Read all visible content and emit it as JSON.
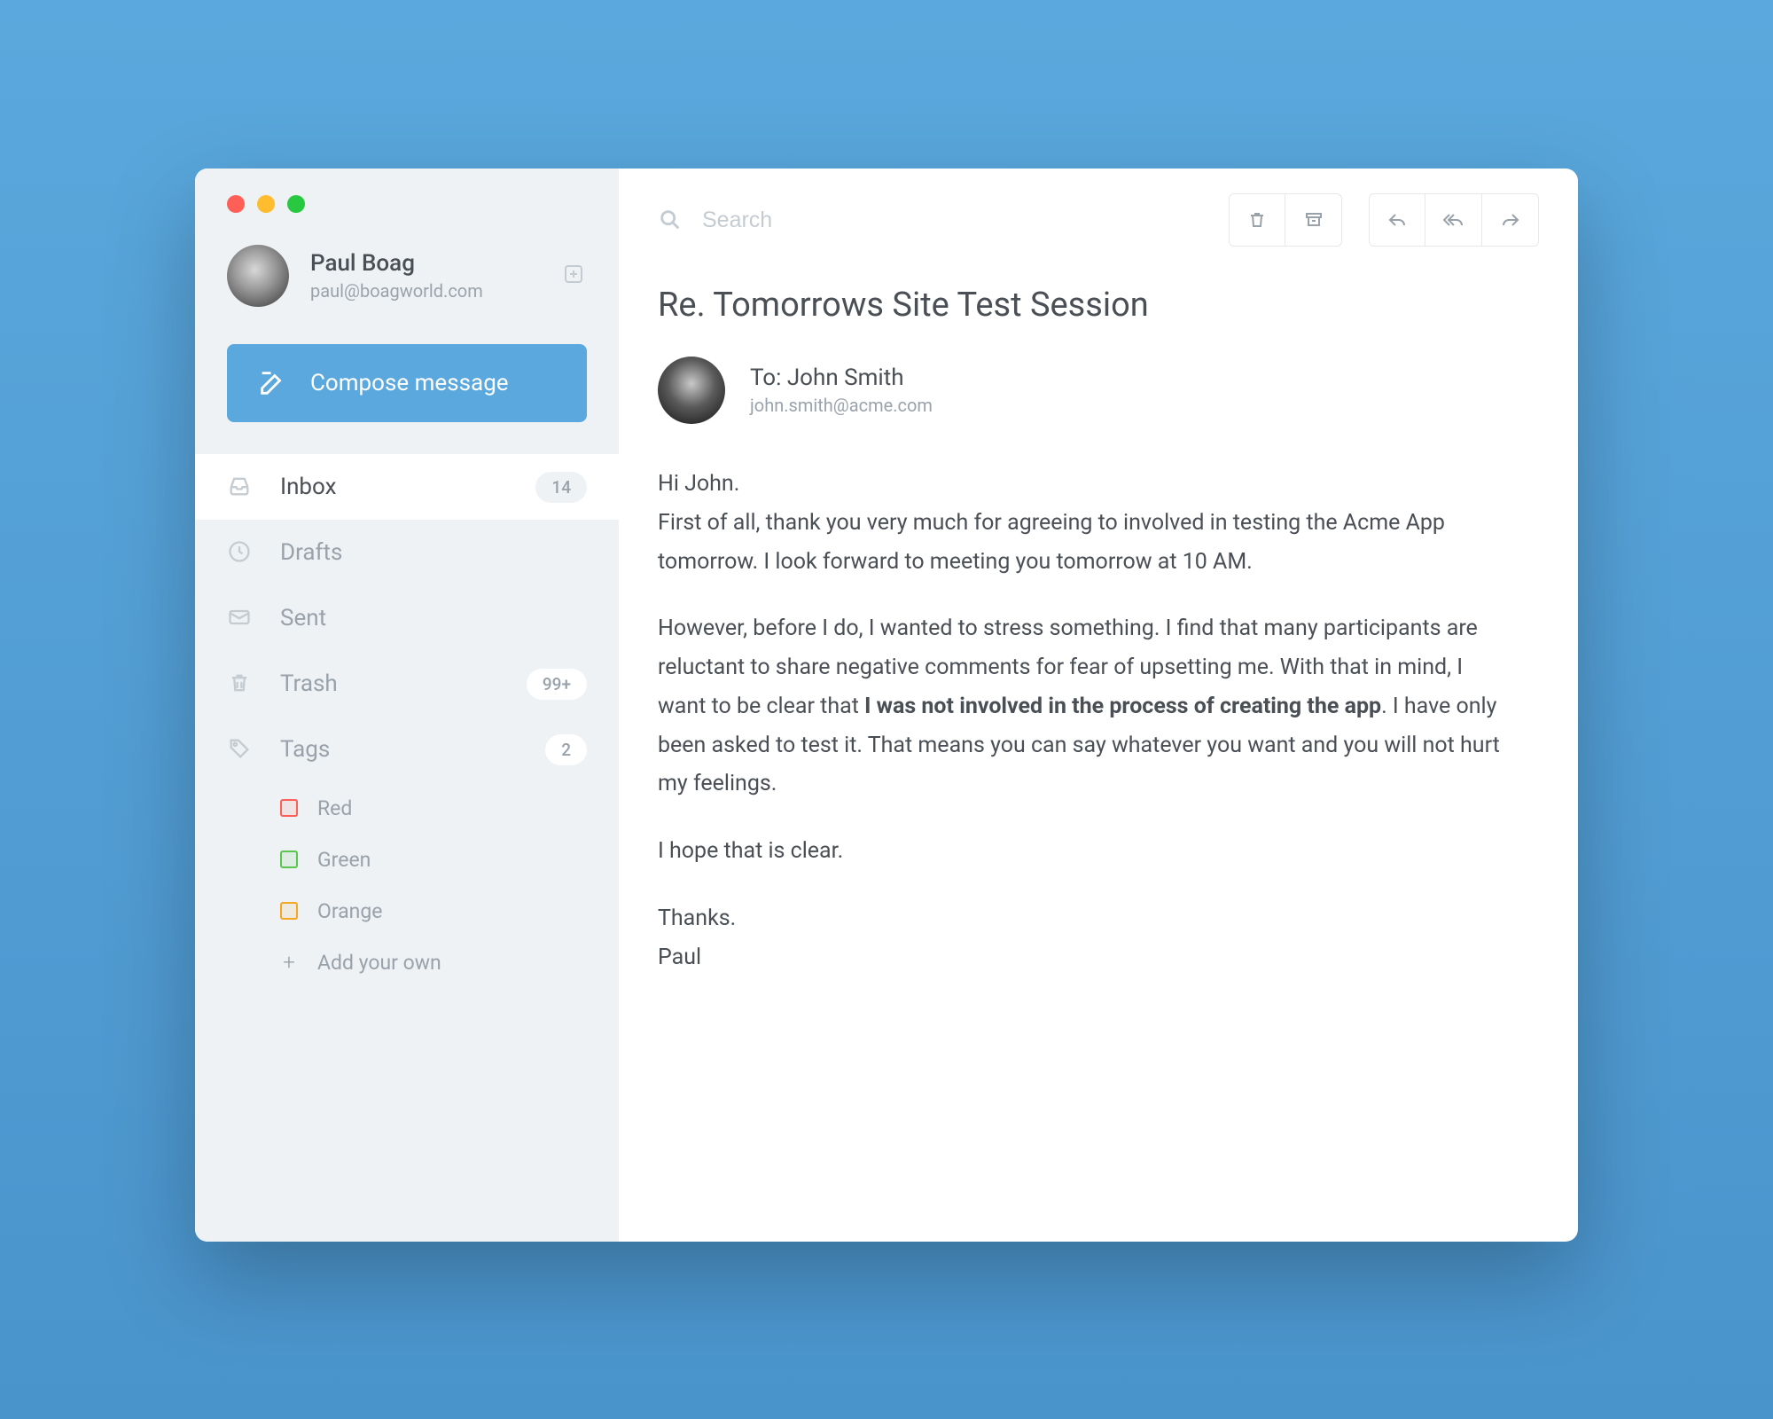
{
  "user": {
    "name": "Paul Boag",
    "email": "paul@boagworld.com"
  },
  "compose": {
    "label": "Compose message"
  },
  "nav": {
    "inbox": {
      "label": "Inbox",
      "badge": "14"
    },
    "drafts": {
      "label": "Drafts"
    },
    "sent": {
      "label": "Sent"
    },
    "trash": {
      "label": "Trash",
      "badge": "99+"
    },
    "tags": {
      "label": "Tags",
      "badge": "2"
    }
  },
  "tags": {
    "red": {
      "label": "Red"
    },
    "green": {
      "label": "Green"
    },
    "orange": {
      "label": "Orange"
    },
    "add": {
      "label": "Add your own"
    }
  },
  "search": {
    "placeholder": "Search"
  },
  "email": {
    "subject": "Re. Tomorrows Site Test Session",
    "to_label": "To: John Smith",
    "to_email": "john.smith@acme.com",
    "para1": "Hi John.",
    "para2": "First of all, thank you very much for agreeing to involved in testing the Acme App tomorrow. I look forward to meeting you tomorrow at 10 AM.",
    "para3a": "However, before I do, I wanted to stress something. I find that many participants are reluctant to share negative comments for fear of upsetting me. With that in mind, I want to be clear that ",
    "para3b": "I was not involved in the process of creating the app",
    "para3c": ". I have only been asked to test it. That means you can say whatever you want and you will not hurt my feelings.",
    "para4": "I hope that is clear.",
    "para5": "Thanks.",
    "para6": "Paul"
  }
}
